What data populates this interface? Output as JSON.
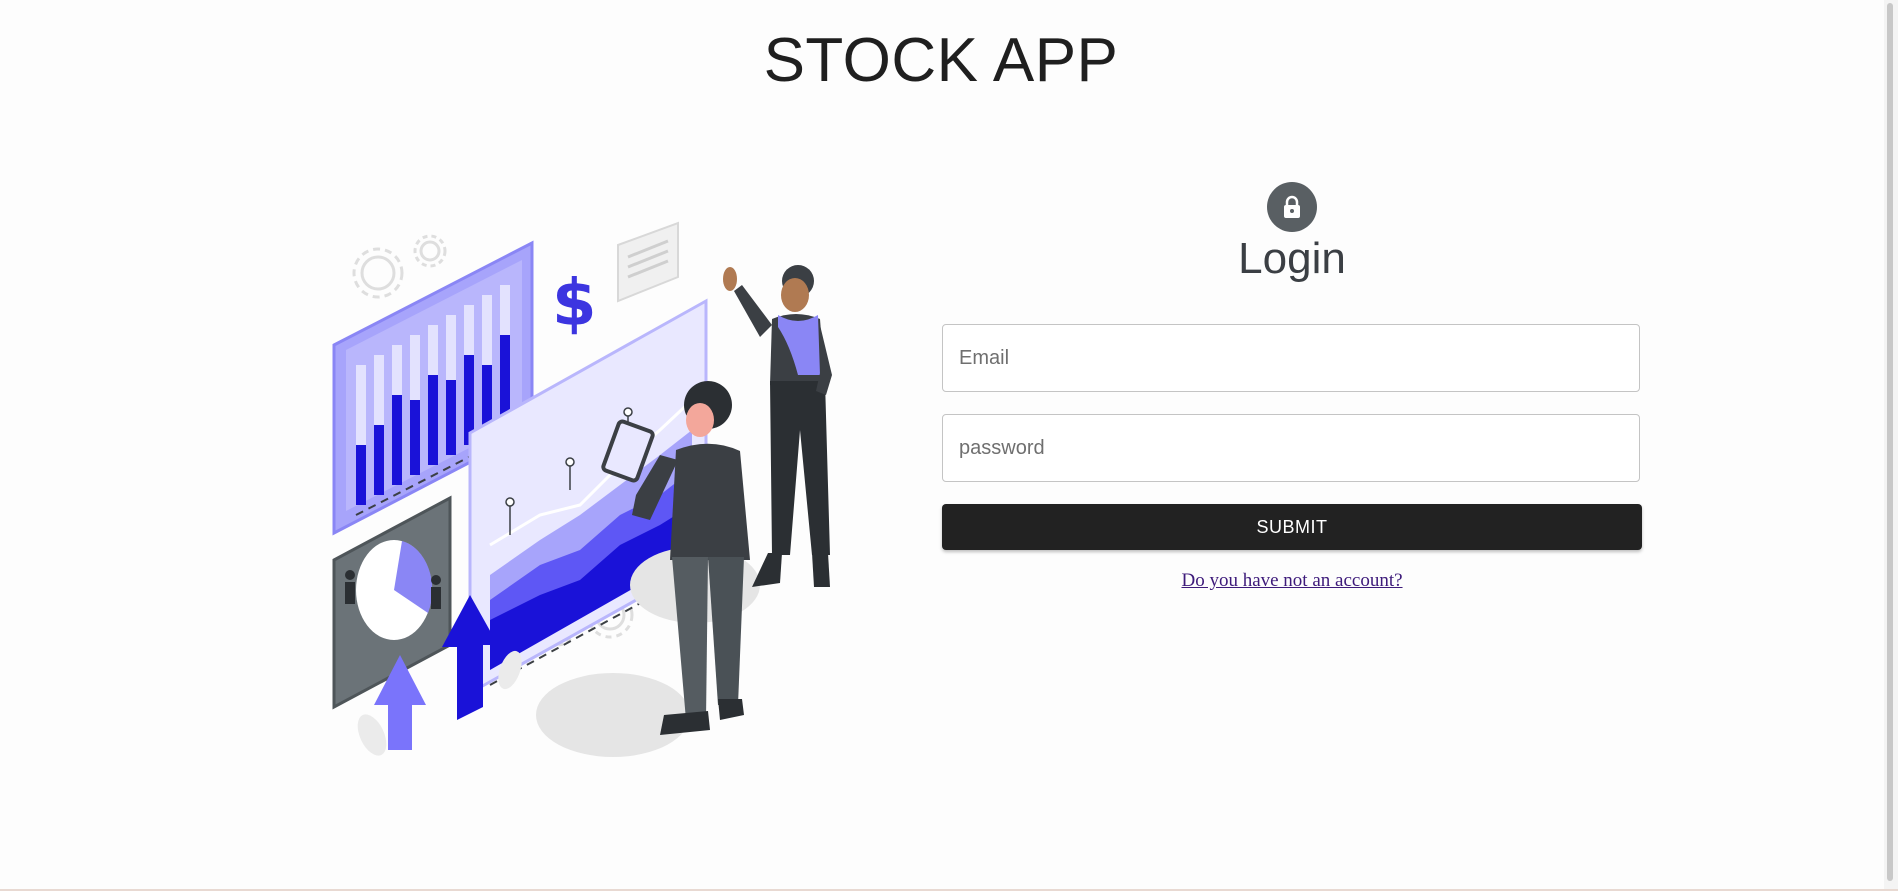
{
  "app": {
    "title": "STOCK APP"
  },
  "illustration": {
    "name": "stock-analytics-illustration"
  },
  "login": {
    "icon": "lock-icon",
    "heading": "Login",
    "email_placeholder": "Email",
    "password_placeholder": "password",
    "submit_label": "SUBMIT",
    "signup_link": "Do you have not an account?"
  },
  "colors": {
    "accent": "#6c63ff",
    "accent_dark": "#1a12d8",
    "button": "#222222",
    "lock_badge": "#595f63",
    "link": "#3d1a7a"
  }
}
